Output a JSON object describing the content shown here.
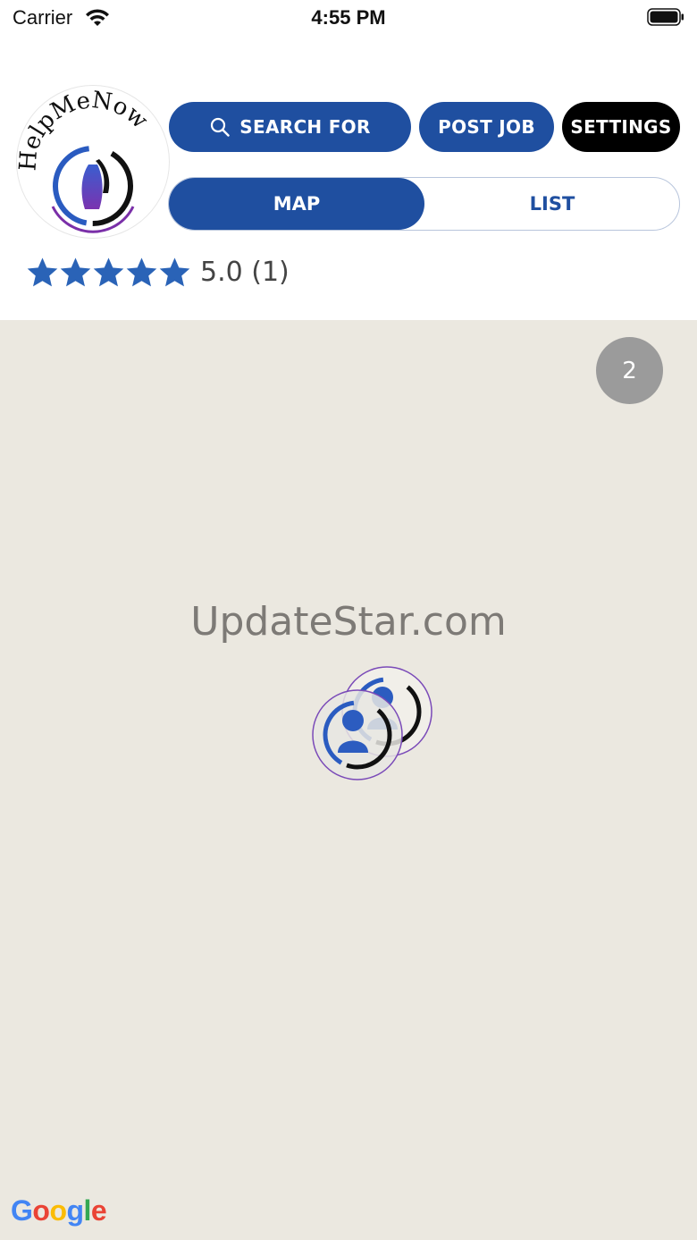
{
  "status_bar": {
    "carrier": "Carrier",
    "time": "4:55 PM"
  },
  "header": {
    "logo_text": "HelpMeNow",
    "search_label": "SEARCH FOR",
    "post_job_label": "POST JOB",
    "settings_label": "SETTINGS",
    "view_toggle": {
      "map_label": "MAP",
      "list_label": "LIST",
      "selected": "MAP"
    },
    "rating": {
      "stars": 5,
      "text": "5.0 (1)"
    }
  },
  "map": {
    "cluster_count": "2",
    "watermark": "UpdateStar.com",
    "attribution_letters": [
      "G",
      "o",
      "o",
      "g",
      "l",
      "e"
    ]
  },
  "colors": {
    "primary_blue": "#1f4fa0",
    "star_blue": "#2a63b7",
    "settings_black": "#000000",
    "map_background": "#ebe8e0",
    "cluster_gray": "#9b9b9b",
    "purple_accent": "#6a3aa0"
  },
  "icons": {
    "search": "search-icon",
    "wifi": "wifi-icon",
    "battery": "battery-icon",
    "star": "star-icon"
  }
}
